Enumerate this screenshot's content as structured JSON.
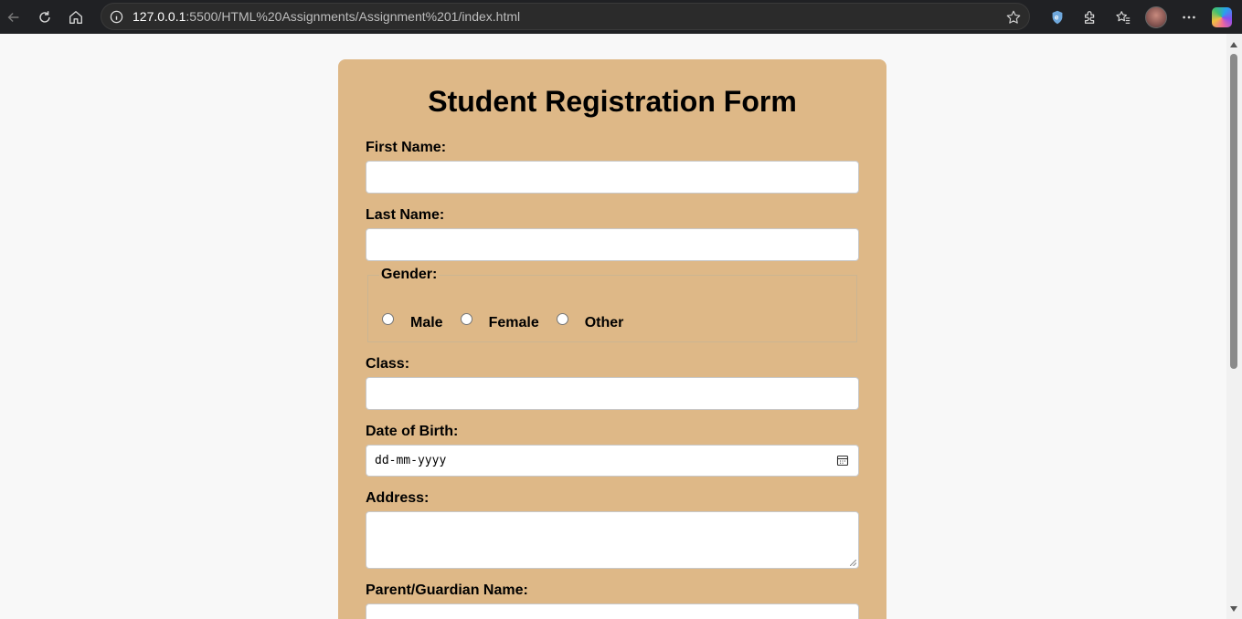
{
  "browser": {
    "url_host": "127.0.0.1",
    "url_path": ":5500/HTML%20Assignments/Assignment%201/index.html"
  },
  "form": {
    "title": "Student Registration Form",
    "first_name_label": "First Name:",
    "last_name_label": "Last Name:",
    "gender": {
      "legend": "Gender:",
      "options": [
        "Male",
        "Female",
        "Other"
      ]
    },
    "class_label": "Class:",
    "dob_label": "Date of Birth:",
    "dob_placeholder": "dd-mm-yyyy",
    "address_label": "Address:",
    "parent_label": "Parent/Guardian Name:"
  },
  "colors": {
    "card_background": "#deb887",
    "page_background": "#f8f8f8",
    "browser_bar": "#202124"
  }
}
